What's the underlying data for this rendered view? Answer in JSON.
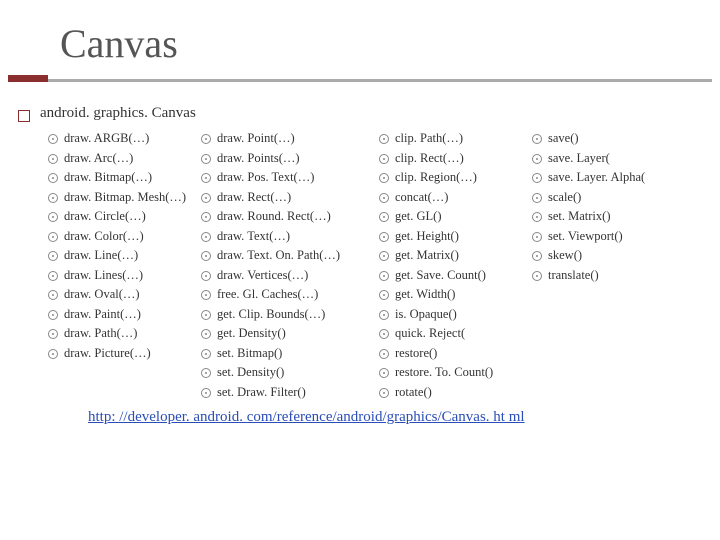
{
  "title": "Canvas",
  "heading": "android. graphics. Canvas",
  "columns": [
    [
      "draw. ARGB(…)",
      "draw. Arc(…)",
      "draw. Bitmap(…)",
      "draw. Bitmap. Mesh(…)",
      "draw. Circle(…)",
      "draw. Color(…)",
      "draw. Line(…)",
      "draw. Lines(…)",
      "draw. Oval(…)",
      "draw. Paint(…)",
      "draw. Path(…)",
      "draw. Picture(…)"
    ],
    [
      "draw. Point(…)",
      "draw. Points(…)",
      "draw. Pos. Text(…)",
      "draw. Rect(…)",
      "draw. Round. Rect(…)",
      "draw. Text(…)",
      "draw. Text. On. Path(…)",
      "draw. Vertices(…)",
      "free. Gl. Caches(…)",
      "get. Clip. Bounds(…)",
      "get. Density()",
      "set. Bitmap()",
      "set. Density()",
      "set. Draw. Filter()"
    ],
    [
      "clip. Path(…)",
      "clip. Rect(…)",
      "clip. Region(…)",
      "concat(…)",
      "get. GL()",
      "get. Height()",
      "get. Matrix()",
      "get. Save. Count()",
      "get. Width()",
      "is. Opaque()",
      "quick. Reject(",
      "restore()",
      "restore. To. Count()",
      "rotate()"
    ],
    [
      "save()",
      "save. Layer(",
      "save. Layer. Alpha(",
      "scale()",
      "set. Matrix()",
      "set. Viewport()",
      "skew()",
      "translate()"
    ]
  ],
  "link": "http: //developer. android. com/reference/android/graphics/Canvas. ht ml"
}
